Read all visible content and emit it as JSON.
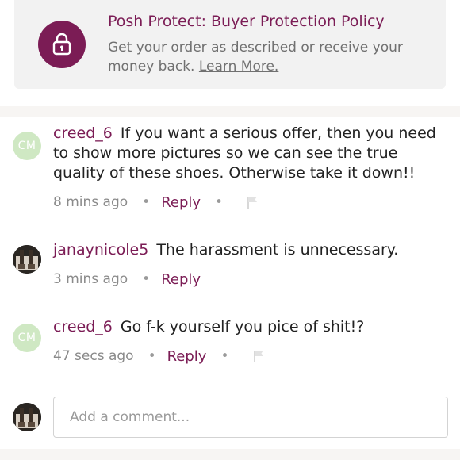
{
  "protect": {
    "title": "Posh Protect: Buyer Protection Policy",
    "description": "Get your order as described or receive your money back.",
    "link": "Learn More.",
    "icon": "lock-icon",
    "accent": "#7b1c55"
  },
  "comments": [
    {
      "avatar_text": "CM",
      "username": "creed_6",
      "text": "If you want a serious offer, then you need to show more pictures so we can see the true quality of these shoes. Otherwise take it down!!",
      "time": "8 mins ago",
      "reply": "Reply",
      "has_flag": true
    },
    {
      "avatar_text": "",
      "username": "janaynicole5",
      "text": "The harassment is unnecessary.",
      "time": "3 mins ago",
      "reply": "Reply",
      "has_flag": false
    },
    {
      "avatar_text": "CM",
      "username": "creed_6",
      "text": "Go f-k yourself you pice of shit!?",
      "time": "47 secs ago",
      "reply": "Reply",
      "has_flag": true
    }
  ],
  "composer": {
    "placeholder": "Add a comment..."
  },
  "colors": {
    "brand": "#7b1c55",
    "avatar_green": "#cfe8c3"
  }
}
